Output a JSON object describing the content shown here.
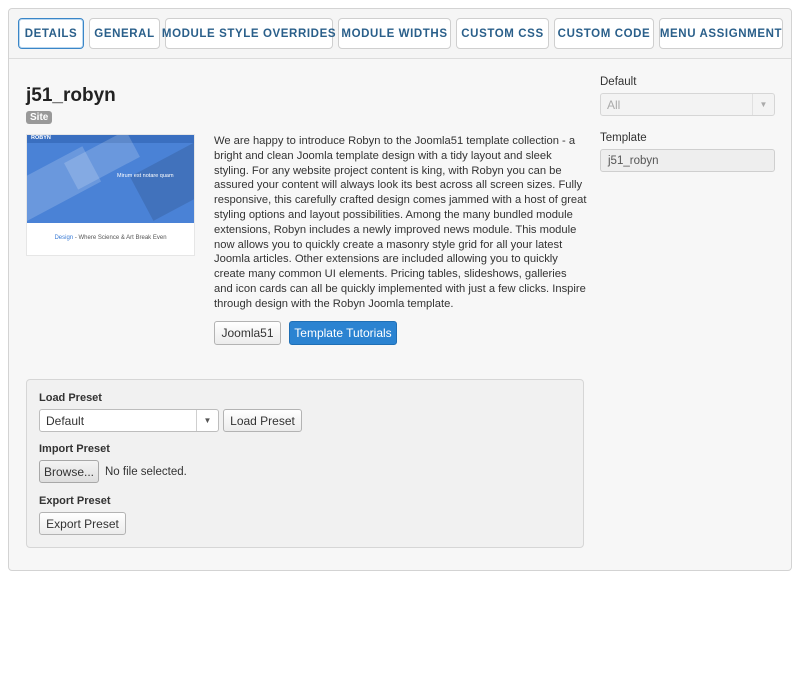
{
  "tabs": [
    {
      "label": "Details",
      "active": true
    },
    {
      "label": "General"
    },
    {
      "label": "Module Style Overrides"
    },
    {
      "label": "Module Widths"
    },
    {
      "label": "Custom CSS"
    },
    {
      "label": "Custom Code"
    },
    {
      "label": "Menu Assignment"
    }
  ],
  "template": {
    "name": "j51_robyn",
    "badge": "Site",
    "description": "We are happy to introduce Robyn to the Joomla51 template collection - a bright and clean Joomla template design with a tidy layout and sleek styling. For any website project content is king, with Robyn you can be assured your content will always look its best across all screen sizes. Fully responsive, this carefully crafted design comes jammed with a host of great styling options and layout possibilities. Among the many bundled module extensions, Robyn includes a newly improved news module. This module now allows you to quickly create a masonry style grid for all your latest Joomla articles. Other extensions are included allowing you to quickly create many common UI elements. Pricing tables, slideshows, galleries and icon cards can all be quickly implemented with just a few clicks. Inspire through design with the Robyn Joomla template.",
    "buttons": {
      "joomla51": "Joomla51",
      "tutorials": "Template Tutorials"
    },
    "thumbnail": {
      "logo": "ROBYN",
      "hero": "Mirum est notare quam",
      "caption_highlight": "Design",
      "caption_rest": " - Where Science & Art Break Even"
    }
  },
  "preset": {
    "load_label": "Load Preset",
    "load_select_value": "Default",
    "load_button": "Load Preset",
    "import_label": "Import Preset",
    "browse_button": "Browse...",
    "file_status": "No file selected.",
    "export_label": "Export Preset",
    "export_button": "Export Preset"
  },
  "sidebar": {
    "default_label": "Default",
    "default_value": "All",
    "template_label": "Template",
    "template_value": "j51_robyn"
  },
  "icons": {
    "dropdown": "chevron-down-icon"
  },
  "colors": {
    "accent": "#2b83d1",
    "tab_text": "#2a5f8a",
    "badge": "#999999"
  }
}
